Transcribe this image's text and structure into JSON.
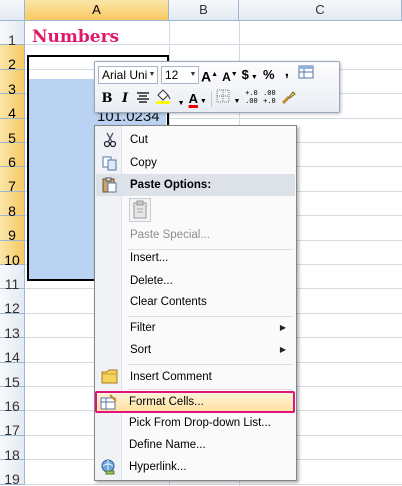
{
  "sheet": {
    "column_headers": [
      "A",
      "B",
      "C"
    ],
    "row_headers": [
      "1",
      "2",
      "3",
      "4",
      "5",
      "6",
      "7",
      "8",
      "9",
      "10",
      "11",
      "12",
      "13",
      "14",
      "15",
      "16",
      "17",
      "18",
      "19"
    ],
    "title_cell": "Numbers",
    "value_cell": "101.0234"
  },
  "mini_toolbar": {
    "font_name": "Arial Uni",
    "font_size": "12",
    "grow_font": "A",
    "shrink_font": "A",
    "currency": "$",
    "percent": "%",
    "comma": ",",
    "bold": "B",
    "italic": "I",
    "font_color": "A",
    "inc_decimal": "+.0\n.00",
    "dec_decimal": ".00\n+.0"
  },
  "context_menu": {
    "cut": "Cut",
    "copy": "Copy",
    "paste_options": "Paste Options:",
    "paste_special": "Paste Special...",
    "insert": "Insert...",
    "delete": "Delete...",
    "clear_contents": "Clear Contents",
    "filter": "Filter",
    "sort": "Sort",
    "insert_comment": "Insert Comment",
    "format_cells": "Format Cells...",
    "pick_list": "Pick From Drop-down List...",
    "define_name": "Define Name...",
    "hyperlink": "Hyperlink..."
  },
  "colors": {
    "title": "#e0186a",
    "selection": "#bad3f2",
    "highlight_border": "#e0147a"
  }
}
